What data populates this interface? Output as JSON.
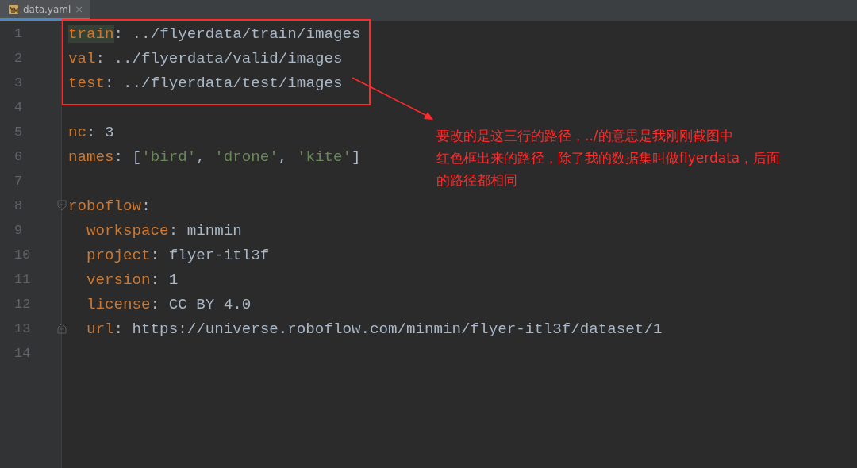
{
  "tabs": [
    {
      "label": "data.yaml",
      "selected": true,
      "close": "×"
    }
  ],
  "lines": [
    {
      "number": "1",
      "tokens": [
        {
          "kind": "key",
          "text": "train",
          "highlighted": true
        },
        {
          "kind": "punct",
          "text": ": "
        },
        {
          "kind": "plain",
          "text": "../flyerdata/train/images"
        }
      ]
    },
    {
      "number": "2",
      "tokens": [
        {
          "kind": "key",
          "text": "val"
        },
        {
          "kind": "punct",
          "text": ": "
        },
        {
          "kind": "plain",
          "text": "../flyerdata/valid/images"
        }
      ]
    },
    {
      "number": "3",
      "tokens": [
        {
          "kind": "key",
          "text": "test"
        },
        {
          "kind": "punct",
          "text": ": "
        },
        {
          "kind": "plain",
          "text": "../flyerdata/test/images"
        }
      ]
    },
    {
      "number": "4"
    },
    {
      "number": "5",
      "tokens": [
        {
          "kind": "key",
          "text": "nc"
        },
        {
          "kind": "punct",
          "text": ": "
        },
        {
          "kind": "plain",
          "text": "3"
        }
      ]
    },
    {
      "number": "6",
      "tokens": [
        {
          "kind": "key",
          "text": "names"
        },
        {
          "kind": "punct",
          "text": ": ["
        },
        {
          "kind": "string",
          "text": "'bird'"
        },
        {
          "kind": "punct",
          "text": ", "
        },
        {
          "kind": "string",
          "text": "'drone'"
        },
        {
          "kind": "punct",
          "text": ", "
        },
        {
          "kind": "string",
          "text": "'kite'"
        },
        {
          "kind": "punct",
          "text": "]"
        }
      ]
    },
    {
      "number": "7"
    },
    {
      "number": "8",
      "tokens": [
        {
          "kind": "key",
          "text": "roboflow"
        },
        {
          "kind": "punct",
          "text": ":"
        }
      ],
      "children": [
        {
          "number": "9",
          "tokens": [
            {
              "kind": "key",
              "text": "workspace"
            },
            {
              "kind": "punct",
              "text": ": "
            },
            {
              "kind": "plain",
              "text": "minmin"
            }
          ]
        },
        {
          "number": "10",
          "tokens": [
            {
              "kind": "key",
              "text": "project"
            },
            {
              "kind": "punct",
              "text": ": "
            },
            {
              "kind": "plain",
              "text": "flyer-itl3f"
            }
          ]
        },
        {
          "number": "11",
          "tokens": [
            {
              "kind": "key",
              "text": "version"
            },
            {
              "kind": "punct",
              "text": ": "
            },
            {
              "kind": "plain",
              "text": "1"
            }
          ]
        },
        {
          "number": "12",
          "tokens": [
            {
              "kind": "key",
              "text": "license"
            },
            {
              "kind": "punct",
              "text": ": "
            },
            {
              "kind": "plain",
              "text": "CC BY 4.0"
            }
          ]
        },
        {
          "number": "13",
          "tokens": [
            {
              "kind": "key",
              "text": "url"
            },
            {
              "kind": "punct",
              "text": ": "
            },
            {
              "kind": "plain",
              "text": "https://universe.roboflow.com/minmin/flyer-itl3f/dataset/1"
            }
          ]
        }
      ]
    },
    {
      "number": "14"
    }
  ],
  "annotation": {
    "lines": [
      "要改的是这三行的路径，../的意思是我刚刚截图中",
      "红色框出来的路径，除了我的数据集叫做flyerdata，后面",
      "的路径都相同"
    ]
  }
}
